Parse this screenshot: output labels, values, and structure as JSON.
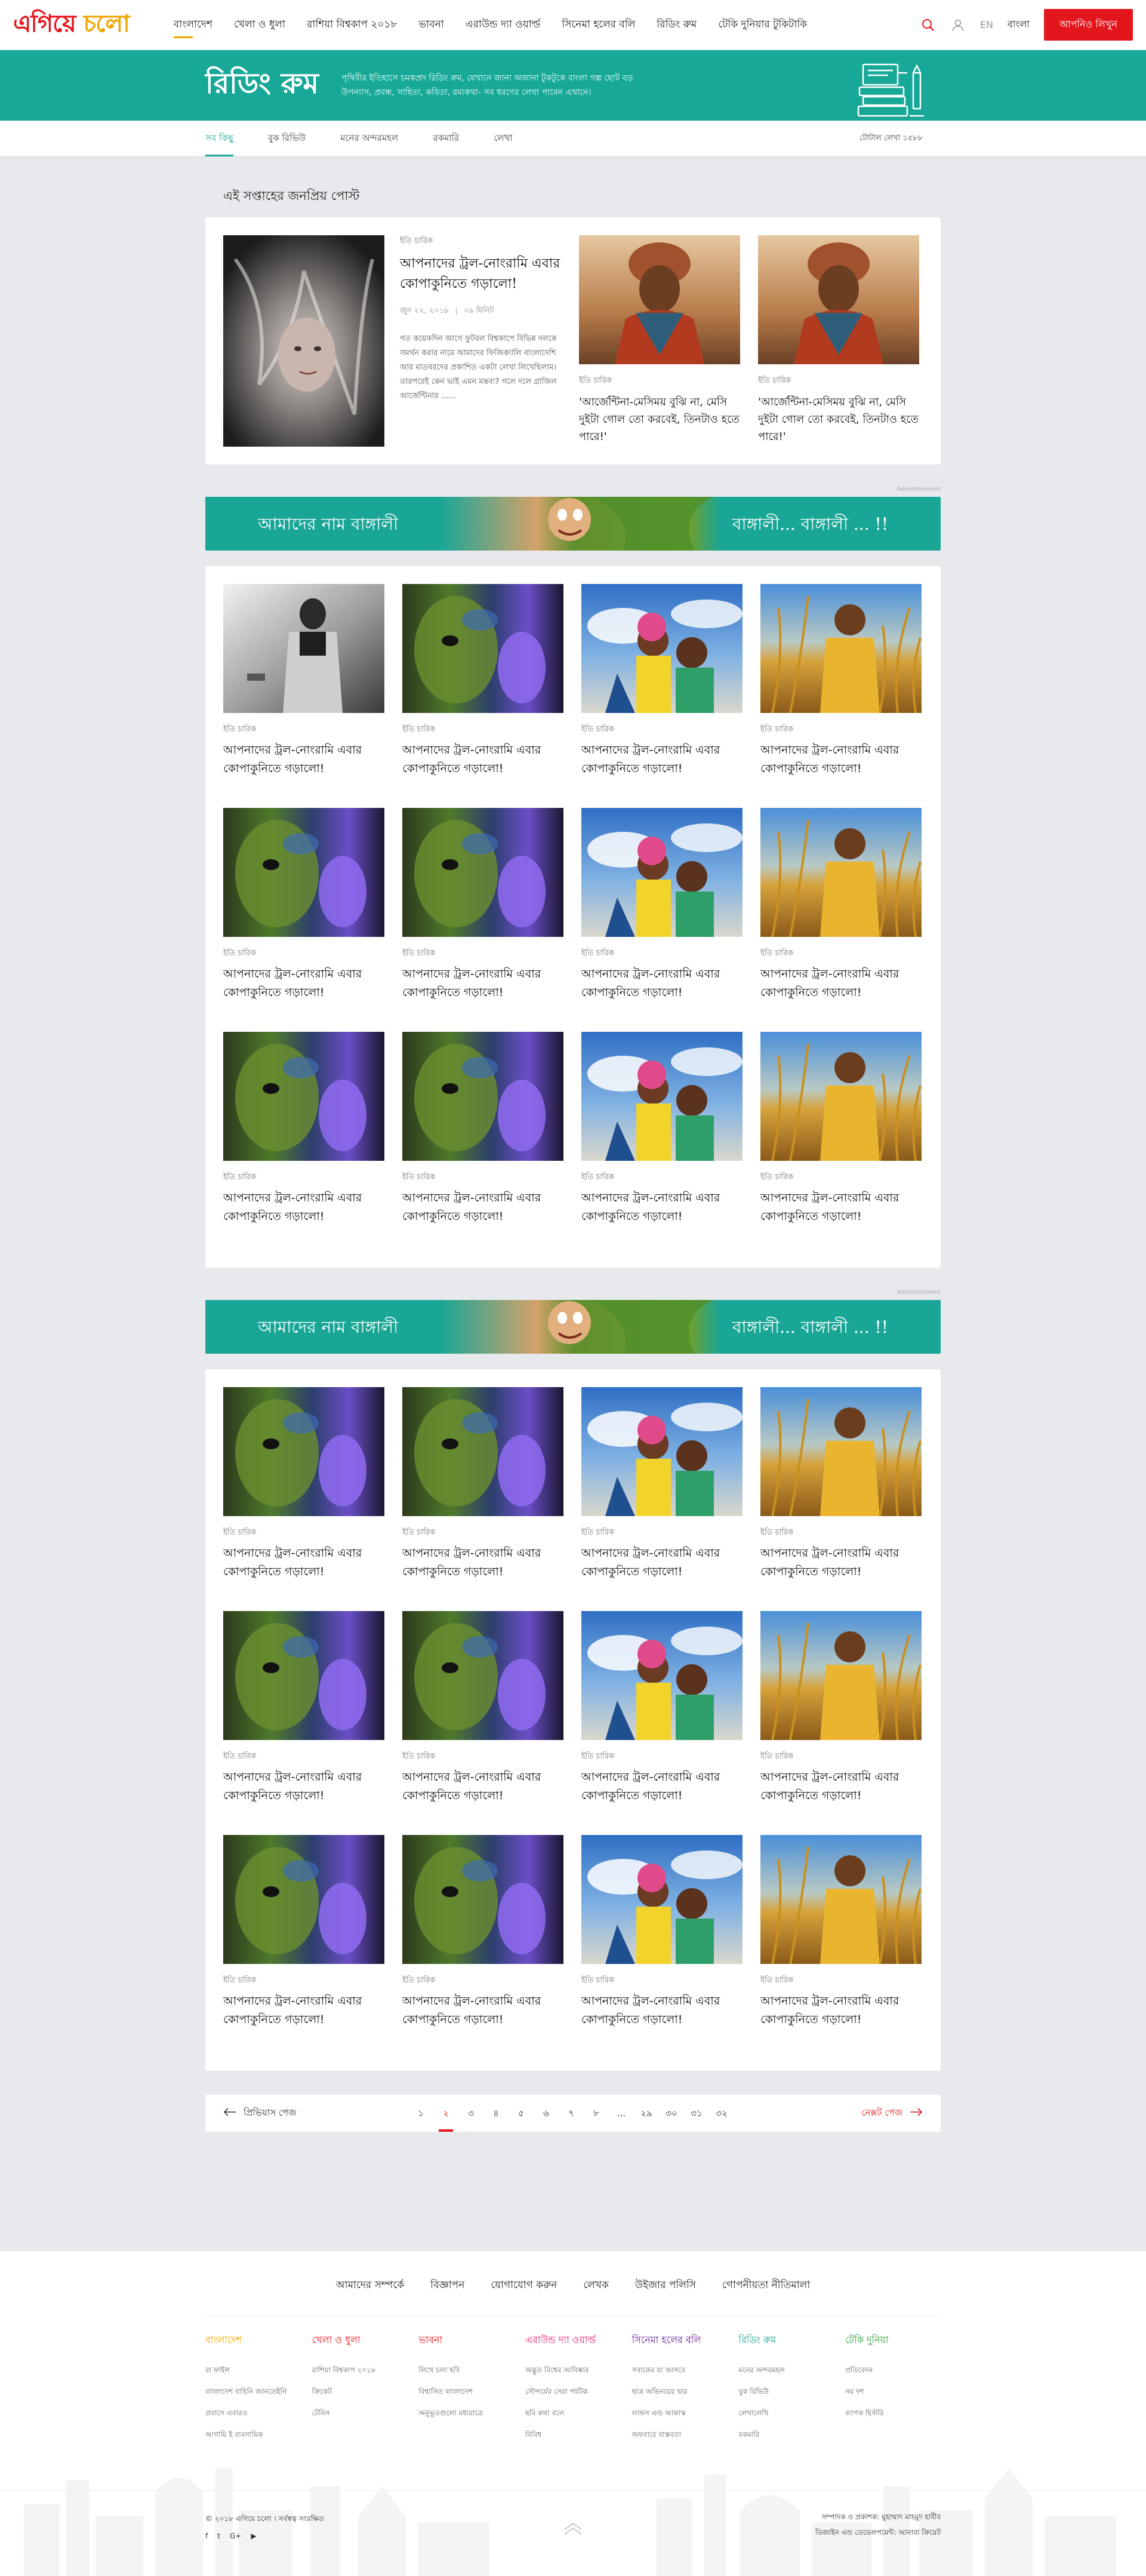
{
  "logo": {
    "part1": "এগিয়ে",
    "part2": "চলো"
  },
  "nav": [
    "বাংলাদেশ",
    "খেলা ও ধুলা",
    "রাশিয়া বিশ্বকাপ ২০১৮",
    "ভাবনা",
    "এরাউন্ড দ্যা ওয়ার্ল্ড",
    "সিনেমা হলের বলি",
    "রিডিং রুম",
    "টেকি দুনিয়ার টুকিটাকি"
  ],
  "header": {
    "lang_en": "EN",
    "lang_bn": "বাংলা",
    "cta": "আপনিও লিখুন"
  },
  "banner": {
    "title": "রিডিং রুম",
    "desc": "পৃথিবীর ইতিহাসে চমকপ্রদ রিডিং রুম, যেখানে জানা অজানা টুকটুকে বাংলা গল্প ছোট বড় উপন্যাস, প্রবন্ধ, সাহিত্য, কবিতা, রম্যকথা- সব ধরণের লেখা পাবেন এখানে।"
  },
  "subnav": {
    "tabs": [
      "সব কিছু",
      "বুক রিভিউ",
      "মনের অন্দরমহল",
      "রকমারি",
      "লেখা"
    ],
    "count": "টোটাল লেখা ১৫৮৮"
  },
  "popular": {
    "title": "এই সপ্তাহের জনপ্রিয় পোস্ট",
    "main": {
      "category": "ইতি চারিক",
      "title": "আপনাদের ট্রল-নোংরামি এবার কোপাকুনিতে গড়ালো!",
      "date": "জুন ২২, ২০১৮",
      "readtime": "০৯ মিনিট",
      "excerpt": "গত কয়েকদিন আগে ফুটবল বিশ্বকাপে বিভিন্ন দলকে সমর্থন করার নামে আমাদের ফিজিক্যালি বাংলাদেশি আর মাতবরদের প্রকাশিত একটা লেখা লিখেছিলাম। তারপরেই কেন ভাই এমন মন্তব্য? গলে দলে গ্রাজিল আর্জেন্টিনার ......"
    },
    "side": [
      {
        "category": "ইতি চারিক",
        "title": "'আর্জেন্টিনা-মেসিময় বুঝি না, মেসি দুইটা গোল তো করবেই, তিনটাও হতে পারে!'"
      },
      {
        "category": "ইতি চারিক",
        "title": "'আর্জেন্টিনা-মেসিময় বুঝি না, মেসি দুইটা গোল তো করবেই, তিনটাও হতে পারে!'"
      }
    ]
  },
  "ad": {
    "label": "Advertisement",
    "left": "আমাদের নাম বাঙ্গালী",
    "right": "বাঙ্গালী... বাঙ্গালী ... !!"
  },
  "post": {
    "category": "ইতি চারিক",
    "title": "আপনাদের ট্রল-নোংরামি এবার কোপাকুনিতে গড়ালো!"
  },
  "pagination": {
    "prev": "প্রিভিয়াস পেজ",
    "next": "নেক্সট পেজ",
    "pages": [
      "১",
      "২",
      "৩",
      "৪",
      "৫",
      "৬",
      "৭",
      "৮",
      "...",
      "২৯",
      "৩০",
      "৩১",
      "৩২"
    ]
  },
  "footer": {
    "links": [
      "আমাদের সম্পর্কে",
      "বিজ্ঞাপন",
      "যোগাযোগ করুন",
      "লেখক",
      "উইজার পলিসি",
      "গোপনীয়তা নীতিমালা"
    ],
    "columns": [
      {
        "head": "বাংলাদেশ",
        "color": "#f0a500",
        "links": [
          "রা ফাইল",
          "বাংলাদেশ বাহিনি জানতেইনি",
          "প্রবাসে এবারও",
          "আগামি ই ব্যবসায়িক"
        ]
      },
      {
        "head": "খেলা ও ধুলা",
        "color": "#e4161d",
        "links": [
          "রাশিয়া বিশ্বকাপ ২০১৮",
          "ক্রিকেট",
          "টেনিস"
        ]
      },
      {
        "head": "ভাবনা",
        "color": "#e4161d",
        "links": [
          "লিখে চলা ছবি",
          "বিশ্বাসিত বাংলাদেশ",
          "অনুভূতগুলো মধ্যরাত্রে"
        ]
      },
      {
        "head": "এরাউন্ড দ্যা ওয়ার্ল্ড",
        "color": "#e61e6e",
        "links": [
          "অদ্ভুত বিশ্বের আবিষ্কার",
          "সৌন্দর্যের সেরা পর্যটক",
          "ছবি কথা বলে",
          "বিবিধ"
        ]
      },
      {
        "head": "সিনেমা হলের বলি",
        "color": "#6a1b9a",
        "links": [
          "সবাকের যা আসবে",
          "ছাত্র অভিনয়ের দ্বার",
          "লাফস এন্ড আকাস্ক",
          "অফবারে বাস্তবতা"
        ]
      },
      {
        "head": "রিডিং রুম",
        "color": "#17a897",
        "links": [
          "মনের অন্দরমহল",
          "বুক রিভিউ",
          "লেখালেখি",
          "রকমারি"
        ]
      },
      {
        "head": "টেকি দুনিয়া",
        "color": "#2e9e3e",
        "links": [
          "প্রতিবেদন",
          "নয় দশ",
          "ব্যাপক হিস্টরি"
        ]
      }
    ],
    "copyright": "© ২০১৮ এগিয়ে চলো । সর্বস্বত্ব সংরক্ষিত",
    "social": [
      "f",
      "t",
      "G+",
      "▶"
    ],
    "credit1": "সম্পাদক ও প্রকাশক: মুহাম্মাদ মাহমুদ হাবীব",
    "credit2": "ডিজাইন এন্ড ডেভেলপমেন্ট: আনাবা ক্রিয়েট"
  }
}
